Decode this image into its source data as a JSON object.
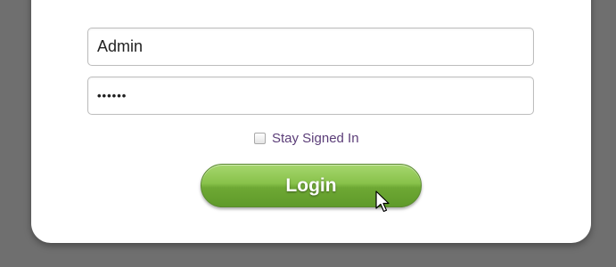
{
  "login_form": {
    "username_value": "Admin",
    "password_value": "••••••",
    "stay_signed_in_label": "Stay Signed In",
    "stay_signed_in_checked": false,
    "login_button_label": "Login"
  },
  "colors": {
    "background": "#6f6f6f",
    "card": "#ffffff",
    "button_green": "#7ab83c",
    "label_purple": "#5b3d78"
  },
  "icons": {
    "cursor": "mouse-pointer-icon"
  }
}
